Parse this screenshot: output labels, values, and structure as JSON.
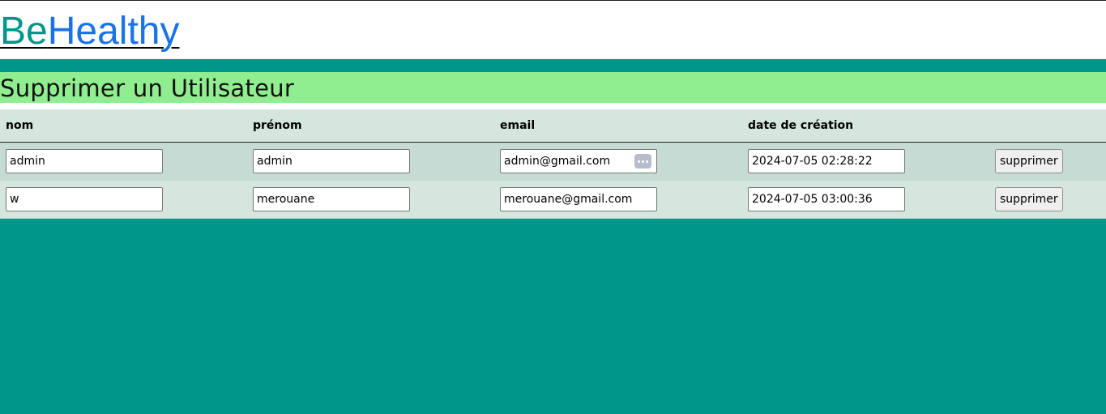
{
  "header": {
    "logo_part1": "Be",
    "logo_part2": "Healthy"
  },
  "page_title": "Supprimer un Utilisateur",
  "table": {
    "columns": [
      "nom",
      "prénom",
      "email",
      "date de création",
      ""
    ],
    "rows": [
      {
        "nom": "admin",
        "prenom": "admin",
        "email": "admin@gmail.com",
        "date_creation": "2024-07-05 02:28:22",
        "action": "supprimer"
      },
      {
        "nom": "w",
        "prenom": "merouane",
        "email": "merouane@gmail.com",
        "date_creation": "2024-07-05 03:00:36",
        "action": "supprimer"
      }
    ]
  },
  "colors": {
    "teal": "#00968a",
    "light_green": "#90ee90",
    "link_blue": "#1a73e8"
  },
  "icons": {
    "email_autofill": "dots-icon"
  }
}
